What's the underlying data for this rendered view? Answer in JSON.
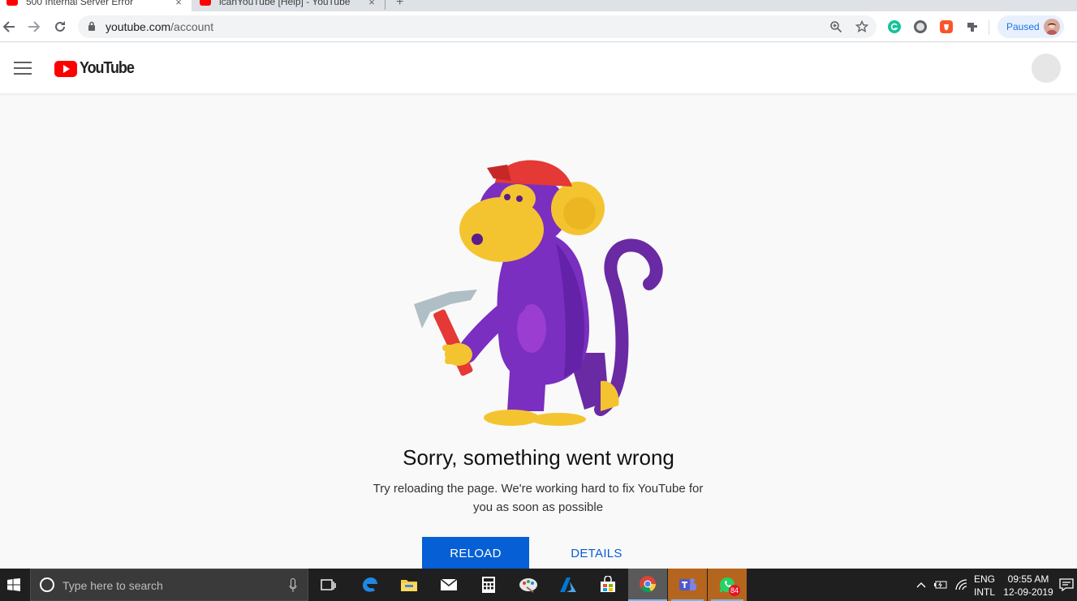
{
  "browser": {
    "tabs": [
      {
        "title": "500 Internal Server Error",
        "close": "×",
        "active": true
      },
      {
        "title": "icanYouTube [Help] - YouTube",
        "close": "×",
        "active": false
      }
    ],
    "new_tab": "+",
    "url_domain": "youtube.com",
    "url_path": "/account",
    "profile_status": "Paused",
    "extensions": [
      "grammarly-icon",
      "circle-extension-icon",
      "brave-extension-icon",
      "puzzle-extension-icon"
    ]
  },
  "youtube": {
    "logo_text": "YouTube",
    "brand_color": "#ff0000"
  },
  "error": {
    "title": "Sorry, something went wrong",
    "message": "Try reloading the page. We're working hard to fix YouTube for you as soon as possible",
    "reload_label": "RELOAD",
    "details_label": "DETAILS",
    "accent": "#065fd4"
  },
  "taskbar": {
    "search_placeholder": "Type here to search",
    "apps": [
      "task-view-icon",
      "edge-icon",
      "file-explorer-icon",
      "mail-icon",
      "calculator-icon",
      "paint-icon",
      "azure-icon",
      "store-icon",
      "chrome-icon",
      "teams-icon",
      "whatsapp-icon"
    ],
    "whatsapp_badge": "84",
    "lang_line1": "ENG",
    "lang_line2": "INTL",
    "time": "09:55 AM",
    "date": "12-09-2019"
  }
}
